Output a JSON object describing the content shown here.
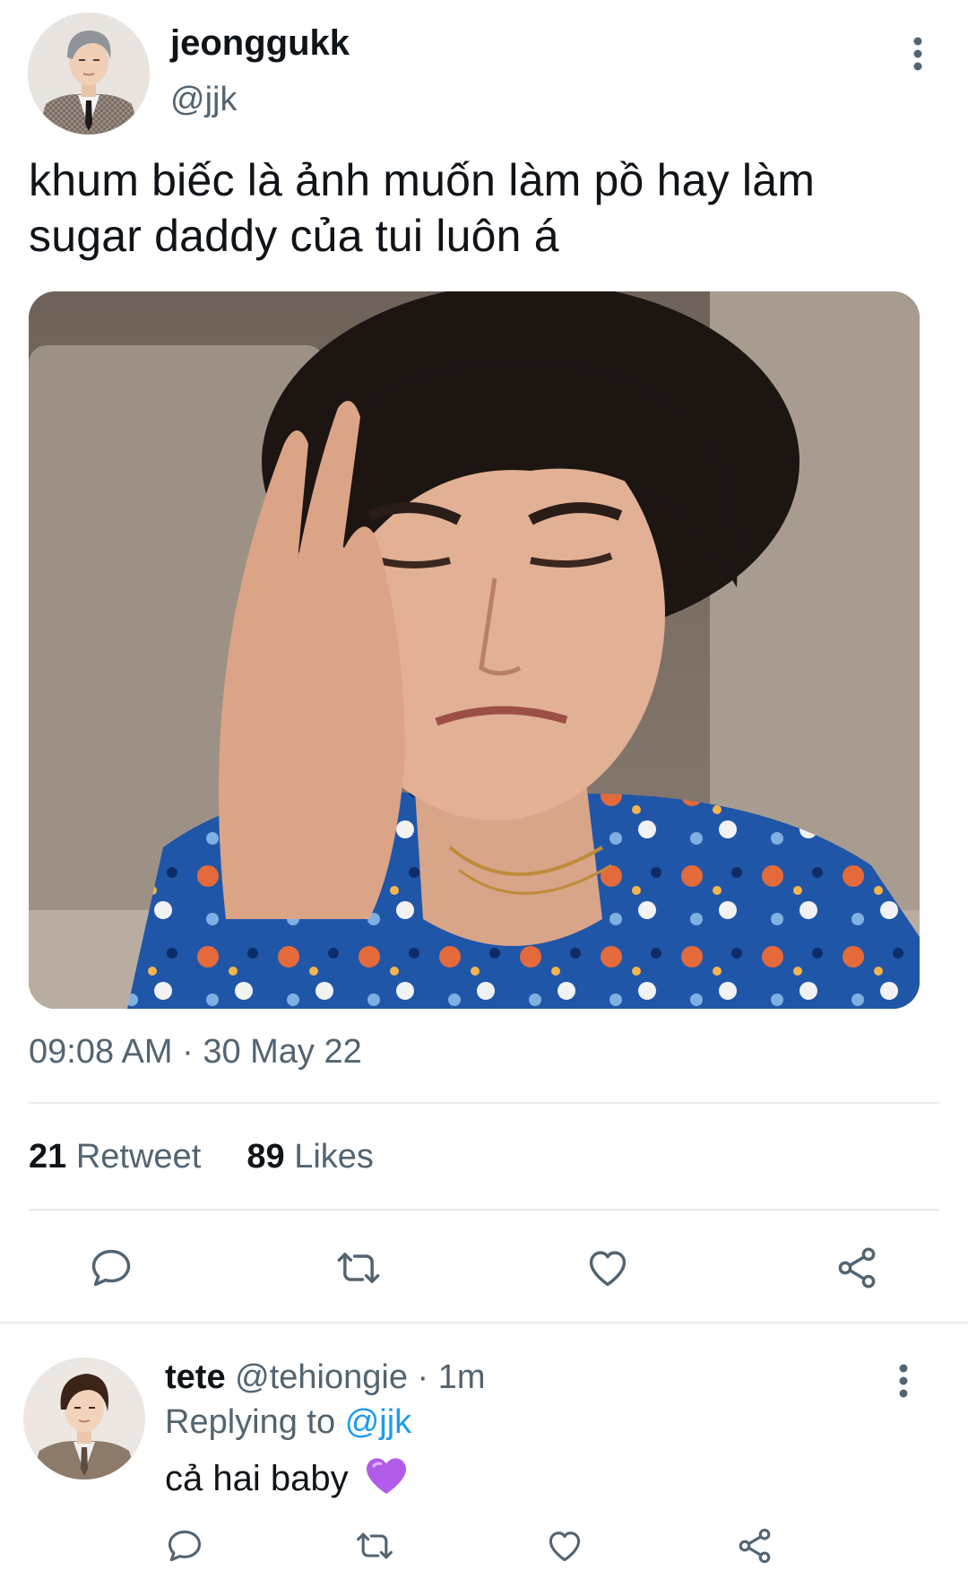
{
  "tweet": {
    "author": {
      "display_name": "jeonggukk",
      "handle": "@jjk"
    },
    "text_line1": "khum biếc là ảnh muốn làm pồ hay làm",
    "text_line2": "sugar daddy của tui luôn á",
    "timestamp": "09:08 AM · 30 May 22",
    "stats": {
      "retweets_count": "21",
      "retweets_label": "Retweet",
      "likes_count": "89",
      "likes_label": "Likes"
    },
    "actions": [
      "reply-icon",
      "retweet-icon",
      "like-icon",
      "share-icon"
    ]
  },
  "reply": {
    "author": {
      "display_name": "tete",
      "handle": "@tehiongie",
      "time": "· 1m"
    },
    "replying_prefix": "Replying to",
    "replying_to": "@jjk",
    "text": "cả hai baby",
    "emoji": "purple-heart-icon",
    "actions": [
      "reply-icon",
      "retweet-icon",
      "like-icon",
      "share-icon"
    ]
  },
  "colors": {
    "text_primary": "#0f1419",
    "text_secondary": "#536471",
    "link": "#1d9bf0",
    "divider": "#e6ecf0",
    "purple_heart": "#b15ce8"
  }
}
